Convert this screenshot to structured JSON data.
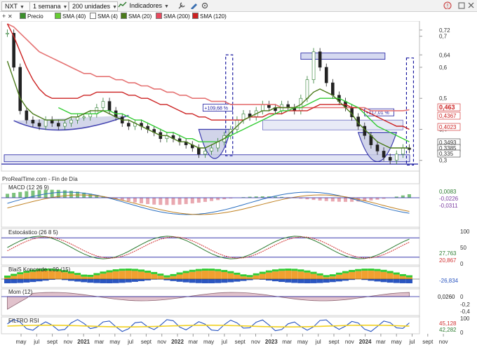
{
  "toolbar": {
    "ticker": "NXT",
    "period": "1 semana",
    "units": "200 unidades",
    "indicators_label": "Indicadores"
  },
  "legend": [
    {
      "label": "Precio",
      "color": "#3a8f2a"
    },
    {
      "label": "SMA (40)",
      "color": "#66cc33"
    },
    {
      "label": "SMA (4)",
      "color": "#ffffff"
    },
    {
      "label": "SMA (20)",
      "color": "#4a7a1a"
    },
    {
      "label": "SMA (200)",
      "color": "#e84a5f"
    },
    {
      "label": "SMA (120)",
      "color": "#cc2222"
    }
  ],
  "source_text": "ProRealTime.com - Fin de Día",
  "colors": {
    "up": "#2e7d32",
    "down": "#222222",
    "sma20": "#4a7a1a",
    "sma40": "#33cc33",
    "sma120": "#cc2222",
    "sma200": "#e57373",
    "band": "#1a1aa0",
    "cup_fill": "#c9cde6"
  },
  "chart_data": [
    {
      "type": "line",
      "panel": "price",
      "ylim": [
        0.27,
        0.74
      ],
      "y_ticks": [
        "0,72",
        "0,7",
        "0,64",
        "0,6",
        "0,5",
        "0,4",
        "0,3"
      ],
      "price_labels": [
        {
          "text": "0,463",
          "color": "#cc2222"
        },
        {
          "text": "0,4367",
          "color": "#cc2222"
        },
        {
          "text": "0,4023",
          "color": "#cc2222"
        },
        {
          "text": "0,3493",
          "color": "#333333"
        },
        {
          "text": "0,3385",
          "color": "#333333"
        },
        {
          "text": "0,335",
          "color": "#333333"
        }
      ],
      "annotations": [
        "+109,68 %",
        "+117,01 %"
      ],
      "x_ticks": [
        "may",
        "jul",
        "sept",
        "nov",
        "2021",
        "mar",
        "may",
        "jul",
        "sept",
        "nov",
        "2022",
        "mar",
        "may",
        "jul",
        "sept",
        "nov",
        "2023",
        "mar",
        "may",
        "jul",
        "sept",
        "nov",
        "2024",
        "mar",
        "may",
        "jul",
        "sept",
        "nov"
      ],
      "close": [
        0.71,
        0.6,
        0.46,
        0.43,
        0.42,
        0.41,
        0.43,
        0.42,
        0.41,
        0.42,
        0.43,
        0.44,
        0.44,
        0.45,
        0.47,
        0.49,
        0.46,
        0.44,
        0.42,
        0.41,
        0.42,
        0.41,
        0.4,
        0.39,
        0.37,
        0.38,
        0.37,
        0.36,
        0.35,
        0.34,
        0.32,
        0.33,
        0.34,
        0.36,
        0.38,
        0.4,
        0.43,
        0.45,
        0.44,
        0.46,
        0.48,
        0.47,
        0.46,
        0.48,
        0.47,
        0.46,
        0.5,
        0.56,
        0.65,
        0.6,
        0.55,
        0.51,
        0.49,
        0.47,
        0.44,
        0.41,
        0.38,
        0.35,
        0.33,
        0.31,
        0.3,
        0.32,
        0.34,
        0.335
      ],
      "sma20": [
        0.62,
        0.56,
        0.5,
        0.47,
        0.45,
        0.44,
        0.43,
        0.43,
        0.43,
        0.43,
        0.44,
        0.44,
        0.45,
        0.46,
        0.46,
        0.46,
        0.45,
        0.44,
        0.43,
        0.43,
        0.42,
        0.41,
        0.4,
        0.39,
        0.38,
        0.38,
        0.37,
        0.36,
        0.36,
        0.35,
        0.34,
        0.34,
        0.35,
        0.36,
        0.37,
        0.39,
        0.41,
        0.43,
        0.44,
        0.45,
        0.46,
        0.46,
        0.47,
        0.47,
        0.47,
        0.47,
        0.48,
        0.5,
        0.52,
        0.53,
        0.52,
        0.51,
        0.49,
        0.47,
        0.45,
        0.42,
        0.4,
        0.38,
        0.36,
        0.35,
        0.34,
        0.34,
        0.34,
        0.34
      ],
      "sma40": [
        null,
        null,
        null,
        null,
        null,
        null,
        null,
        null,
        0.47,
        0.46,
        0.45,
        0.45,
        0.45,
        0.45,
        0.45,
        0.46,
        0.46,
        0.45,
        0.45,
        0.44,
        0.43,
        0.43,
        0.42,
        0.41,
        0.4,
        0.39,
        0.39,
        0.38,
        0.37,
        0.37,
        0.36,
        0.36,
        0.36,
        0.36,
        0.37,
        0.38,
        0.39,
        0.4,
        0.41,
        0.42,
        0.43,
        0.44,
        0.45,
        0.46,
        0.46,
        0.47,
        0.47,
        0.48,
        0.49,
        0.5,
        0.5,
        0.5,
        0.5,
        0.49,
        0.48,
        0.47,
        0.45,
        0.43,
        0.41,
        0.4,
        0.39,
        0.38,
        0.37,
        0.36
      ],
      "sma120": [
        0.74,
        0.7,
        0.65,
        0.6,
        0.56,
        0.53,
        0.51,
        0.5,
        0.5,
        0.5,
        0.5,
        0.5,
        0.51,
        0.51,
        0.52,
        0.52,
        0.52,
        0.52,
        0.52,
        0.51,
        0.51,
        0.5,
        0.5,
        0.49,
        0.48,
        0.48,
        0.47,
        0.46,
        0.45,
        0.45,
        0.44,
        0.44,
        0.43,
        0.43,
        0.43,
        0.43,
        0.43,
        0.43,
        0.44,
        0.44,
        0.44,
        0.45,
        0.45,
        0.45,
        0.46,
        0.46,
        0.46,
        0.46,
        0.47,
        0.48,
        0.48,
        0.48,
        0.48,
        0.48,
        0.47,
        0.47,
        0.46,
        0.45,
        0.44,
        0.43,
        0.42,
        0.41,
        0.41,
        0.4
      ],
      "sma200": [
        0.74,
        0.73,
        0.71,
        0.69,
        0.67,
        0.65,
        0.64,
        0.63,
        0.62,
        0.61,
        0.6,
        0.59,
        0.58,
        0.58,
        0.57,
        0.57,
        0.57,
        0.56,
        0.56,
        0.55,
        0.55,
        0.54,
        0.54,
        0.53,
        0.53,
        0.52,
        0.52,
        0.51,
        0.51,
        0.5,
        0.5,
        0.5,
        0.49,
        0.49,
        0.49,
        0.48,
        0.48,
        0.48,
        0.48,
        0.48,
        0.48,
        0.48,
        0.48,
        0.47,
        0.47,
        0.47,
        0.47,
        0.47,
        0.47,
        0.47,
        0.47,
        0.47,
        0.47,
        0.47,
        0.47,
        0.47,
        0.47,
        0.46,
        0.46,
        0.46,
        0.46,
        0.46,
        0.46,
        0.463
      ]
    },
    {
      "type": "bar",
      "panel": "macd",
      "title": "MACD (12 26 9)",
      "value_labels": [
        "0,0083",
        "-0,0226",
        "-0,0311"
      ],
      "ylim": [
        -0.08,
        0.06
      ]
    },
    {
      "type": "line",
      "panel": "stochastic",
      "title": "Estocástico (26 8 5)",
      "y_ticks": [
        "100",
        "50",
        "0"
      ],
      "value_labels": [
        "27,763",
        "20,867"
      ],
      "ylim": [
        0,
        100
      ]
    },
    {
      "type": "area",
      "panel": "konc",
      "title": "BlaiS Koncorde v.09 (15)",
      "value_labels": [
        "-26,834"
      ]
    },
    {
      "type": "area",
      "panel": "momentum",
      "title": "Mom (12)",
      "y_ticks": [
        "0",
        "-0,2",
        "-0,4"
      ],
      "value_labels": [
        "0,0260"
      ]
    },
    {
      "type": "line",
      "panel": "rsi",
      "title": "FILTRO RSI",
      "y_ticks": [
        "100",
        "0"
      ],
      "value_labels": [
        "45,128",
        "42,282"
      ]
    }
  ]
}
